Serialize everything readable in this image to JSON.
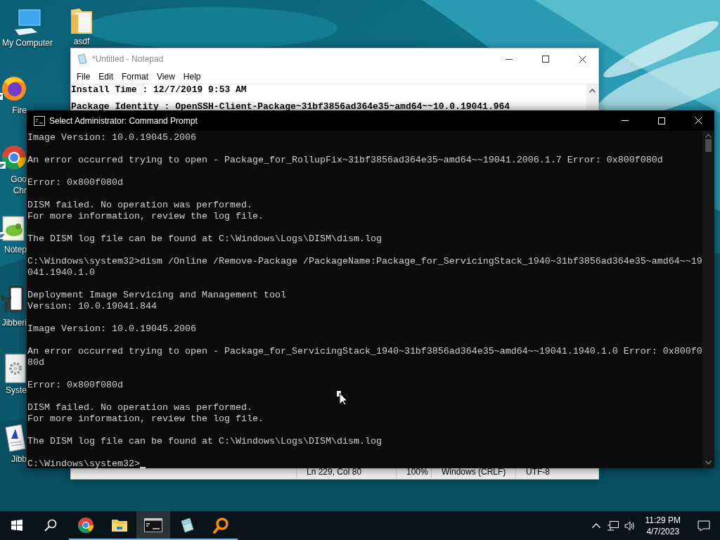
{
  "desktop_icons": [
    {
      "kind": "computer",
      "lines": [
        "My Computer"
      ]
    },
    {
      "kind": "folder",
      "lines": [
        "asdf"
      ]
    },
    {
      "kind": "firefox",
      "lines": [
        "Fire"
      ]
    },
    {
      "kind": "chrome",
      "lines": [
        "Goo",
        "Chr"
      ]
    },
    {
      "kind": "notepadpp",
      "lines": [
        "Notep"
      ]
    },
    {
      "kind": "wrench",
      "lines": [
        "Jibberi"
      ]
    },
    {
      "kind": "settings",
      "lines": [
        "Syste"
      ]
    },
    {
      "kind": "document",
      "lines": [
        "Jibb"
      ]
    }
  ],
  "notepad": {
    "title": "*Untitled - Notepad",
    "menu": [
      "File",
      "Edit",
      "Format",
      "View",
      "Help"
    ],
    "lines": [
      "Install Time : 12/7/2019 9:53 AM",
      "Package Identity : OpenSSH-Client-Package~31bf3856ad364e35~amd64~~10.0.19041.964"
    ],
    "status": [
      "Ln 229, Col 80",
      "100%",
      "Windows (CRLF)",
      "UTF-8"
    ]
  },
  "console": {
    "title": "Select Administrator: Command Prompt",
    "blocks": [
      [
        "Image Version: 10.0.19045.2006"
      ],
      [
        "An error occurred trying to open - Package_for_RollupFix~31bf3856ad364e35~amd64~~19041.2006.1.7 Error: 0x800f080d"
      ],
      [
        "Error: 0x800f080d"
      ],
      [
        "DISM failed. No operation was performed.",
        "For more information, review the log file."
      ],
      [
        "The DISM log file can be found at C:\\Windows\\Logs\\DISM\\dism.log"
      ],
      [
        "C:\\Windows\\system32>dism /Online /Remove-Package /PackageName:Package_for_ServicingStack_1940~31bf3856ad364e35~amd64~~19",
        "041.1940.1.0"
      ],
      [
        "Deployment Image Servicing and Management tool",
        "Version: 10.0.19041.844"
      ],
      [
        "Image Version: 10.0.19045.2006"
      ],
      [
        "An error occurred trying to open - Package_for_ServicingStack_1940~31bf3856ad364e35~amd64~~19041.1940.1.0 Error: 0x800f0",
        "80d"
      ],
      [
        "Error: 0x800f080d"
      ],
      [
        "DISM failed. No operation was performed.",
        "For more information, review the log file."
      ],
      [
        "The DISM log file can be found at C:\\Windows\\Logs\\DISM\\dism.log"
      ]
    ],
    "prompt": "C:\\Windows\\system32>"
  },
  "taskbar": {
    "apps": [
      {
        "kind": "chrome",
        "open": true,
        "active": false
      },
      {
        "kind": "folder",
        "open": true,
        "active": false
      },
      {
        "kind": "console",
        "open": true,
        "active": true
      },
      {
        "kind": "notepad",
        "open": true,
        "active": false
      },
      {
        "kind": "magnifier",
        "open": true,
        "active": false
      }
    ],
    "clock": {
      "time": "11:29 PM",
      "date": "4/7/2023"
    }
  }
}
